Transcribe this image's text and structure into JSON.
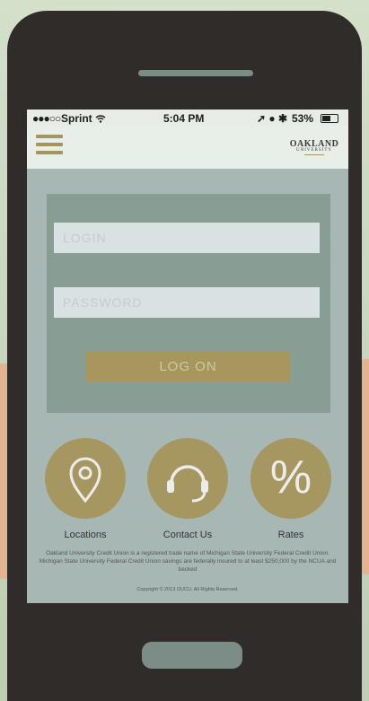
{
  "status_bar": {
    "signal": "●●●○○",
    "carrier": "Sprint",
    "wifi_icon": "wifi-icon",
    "time": "5:04 PM",
    "icons": "➚ ● ✱",
    "battery": "53%"
  },
  "header": {
    "menu_icon": "hamburger-menu-icon",
    "logo_line1": "OAKLAND",
    "logo_line2": "UNIVERSITY"
  },
  "login": {
    "login_placeholder": "LOGIN",
    "password_placeholder": "PASSWORD",
    "logon_label": "LOG ON"
  },
  "shortcuts": [
    {
      "label": "Locations",
      "icon": "location-pin-icon"
    },
    {
      "label": "Contact Us",
      "icon": "headset-icon"
    },
    {
      "label": "Rates",
      "icon": "percent-icon",
      "glyph": "%"
    }
  ],
  "footer": {
    "disclaimer": "Oakland University Credit Union is a registered trade name of Michigan State University Federal Credit Union. Michigan State University Federal Credit Union savings are federally insured to at least $250,000 by the NCUA and backed",
    "copyright": "Copyright © 2013 OUCU. All Rights Reserved."
  },
  "colors": {
    "accent_gold": "#a6965f",
    "panel": "#889e95",
    "screen_bg": "#a7b8b4",
    "phone_body": "#2f2c29"
  }
}
